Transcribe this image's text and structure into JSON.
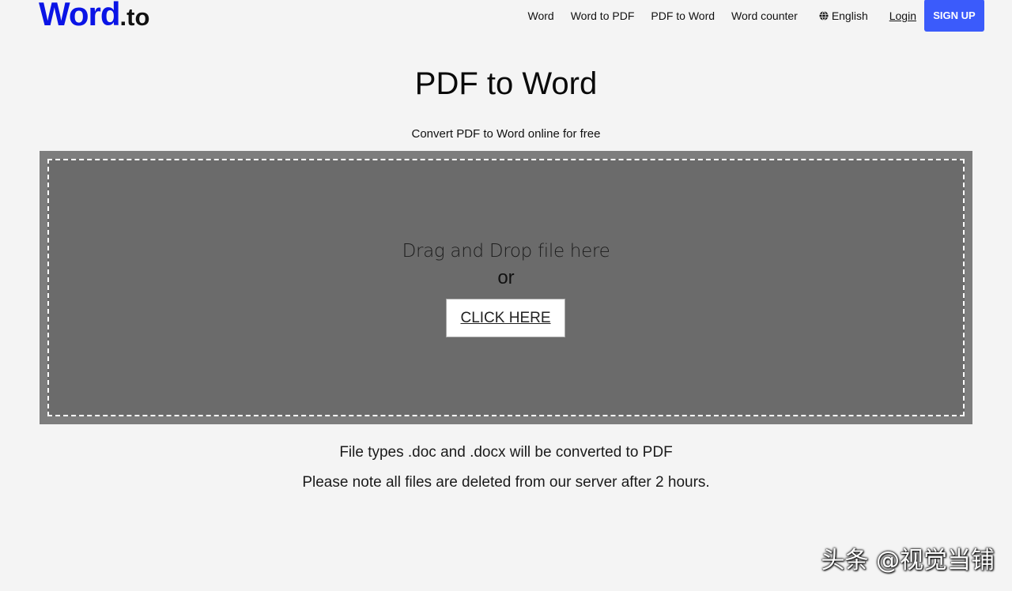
{
  "header": {
    "logo_main": "Word",
    "logo_tld": ".to",
    "nav": [
      {
        "label": "Word"
      },
      {
        "label": "Word to PDF"
      },
      {
        "label": "PDF to Word"
      },
      {
        "label": "Word counter"
      }
    ],
    "language": "English",
    "language_icon": "globe-icon",
    "login": "Login",
    "signup": "SIGN UP"
  },
  "main": {
    "title": "PDF to Word",
    "subtitle": "Convert PDF to Word online for free",
    "dropzone": {
      "text": "Drag and Drop file here",
      "or": "or",
      "button": "CLICK HERE"
    },
    "info": [
      "File types .doc and .docx will be converted to PDF",
      "Please note all files are deleted from our server after 2 hours."
    ]
  },
  "watermark": "头条 @视觉当铺",
  "colors": {
    "brand_blue": "#0a14e6",
    "signup_bg": "#3b5bfb",
    "dropzone_outer": "#7d7d7d",
    "dropzone_inner": "#6b6b6b",
    "page_bg": "#f4f4f4"
  }
}
